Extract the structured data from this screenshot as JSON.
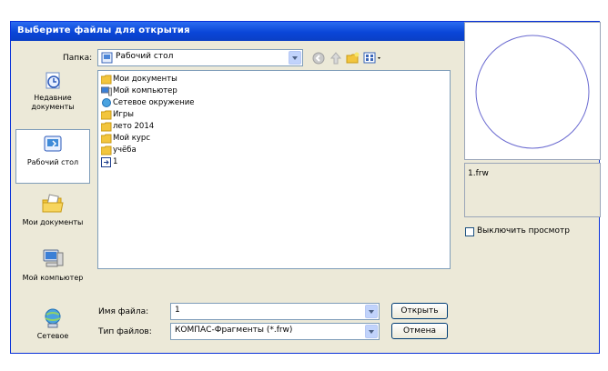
{
  "dialog": {
    "title": "Выберите файлы для открытия",
    "help_label": "?",
    "close_label": "X"
  },
  "toolbar": {
    "look_in_label": "Папка:",
    "look_in_value": "Рабочий стол"
  },
  "places": [
    {
      "label": "Недавние документы",
      "icon": "recent-documents-icon"
    },
    {
      "label": "Рабочий стол",
      "icon": "desktop-icon"
    },
    {
      "label": "Мои документы",
      "icon": "my-documents-icon"
    },
    {
      "label": "Мой компьютер",
      "icon": "my-computer-icon"
    },
    {
      "label": "Сетевое",
      "icon": "network-icon"
    }
  ],
  "files": [
    {
      "name": "Мои документы",
      "icon": "folder-icon"
    },
    {
      "name": "Мой компьютер",
      "icon": "computer-icon"
    },
    {
      "name": "Сетевое окружение",
      "icon": "network-icon"
    },
    {
      "name": "Игры",
      "icon": "folder-icon"
    },
    {
      "name": "лето 2014",
      "icon": "folder-icon"
    },
    {
      "name": "Мой курс",
      "icon": "folder-icon"
    },
    {
      "name": "учёба",
      "icon": "folder-icon"
    },
    {
      "name": "1",
      "icon": "fragment-file-icon"
    }
  ],
  "form": {
    "filename_label": "Имя файла:",
    "filename_value": "1",
    "filetype_label": "Тип файлов:",
    "filetype_value": "КОМПАС-Фрагменты (*.frw)",
    "open_label": "Открыть",
    "cancel_label": "Отмена"
  },
  "preview": {
    "filename": "1.frw",
    "disable_preview_label": "Выключить просмотр",
    "disable_preview_checked": false
  },
  "colors": {
    "titlebar": "#0a46d8",
    "dialog_bg": "#ece9d8",
    "border": "#7f9db9",
    "preview_circle": "#6a6ad0"
  }
}
